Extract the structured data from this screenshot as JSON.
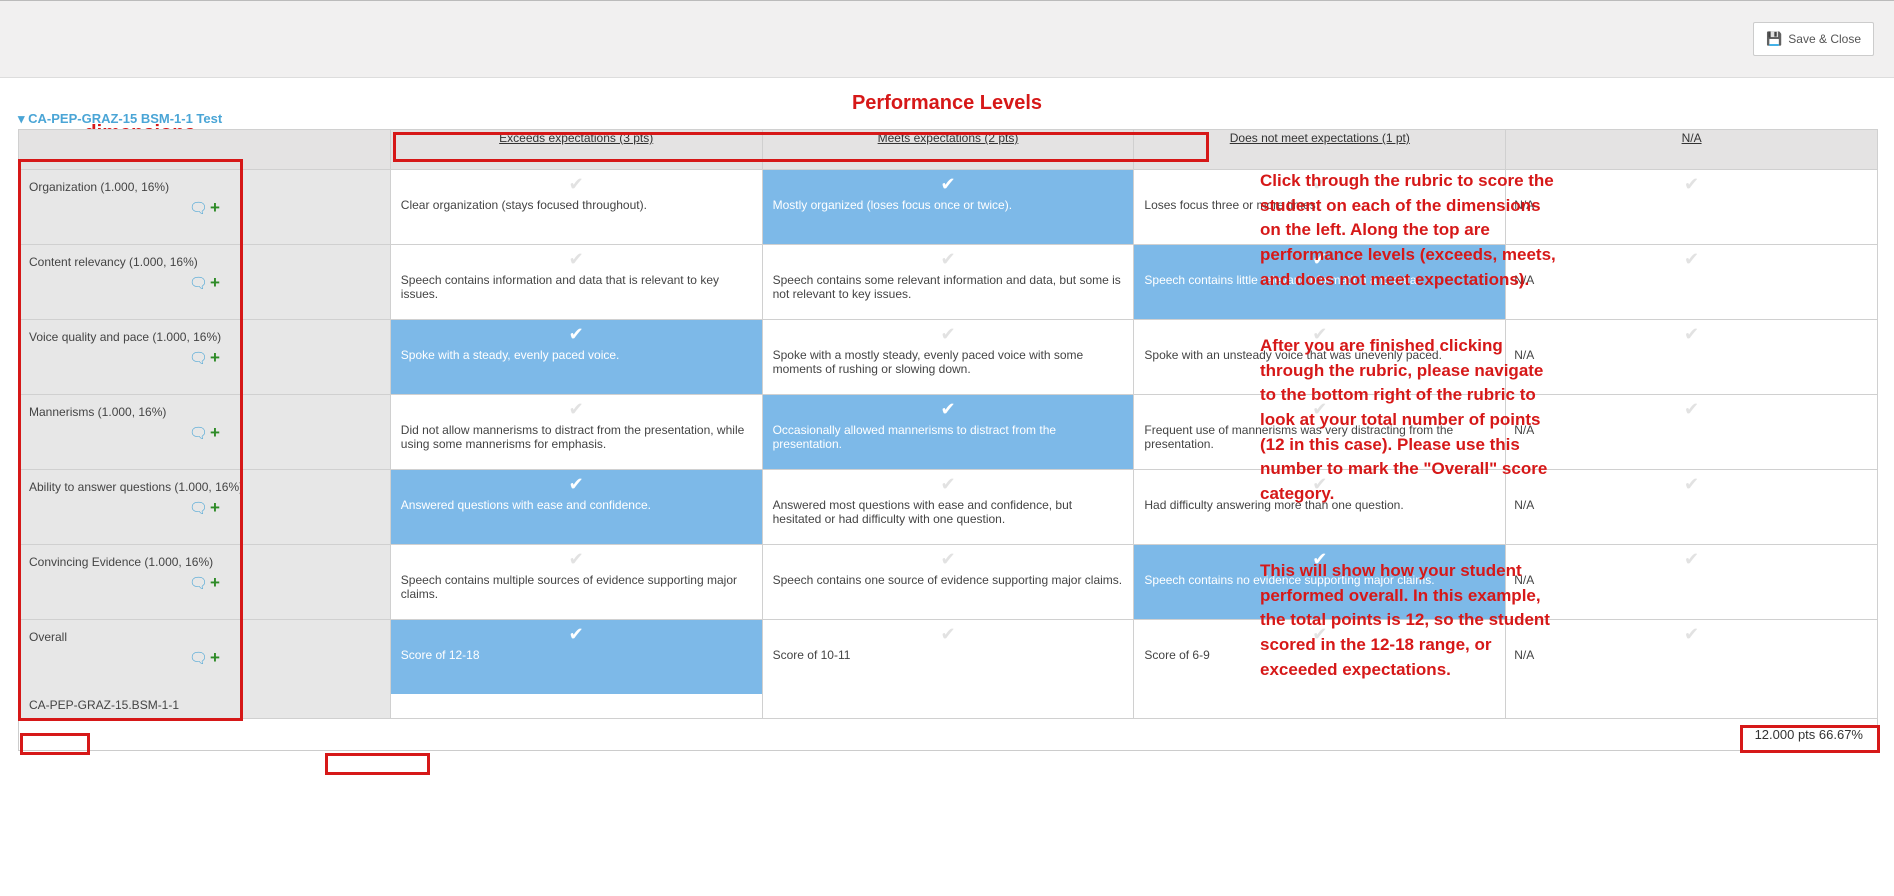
{
  "toolbar": {
    "save_close": "Save & Close"
  },
  "labels": {
    "performance_levels": "Performance Levels",
    "dimensions": "dimensions",
    "breadcrumb": "▾ CA-PEP-GRAZ-15 BSM-1-1 Test"
  },
  "headers": {
    "exceeds": "Exceeds expectations (3 pts)",
    "meets": "Meets expectations (2 pts)",
    "doesnot": "Does not meet expectations (1 pt)",
    "na": "N/A"
  },
  "rows": [
    {
      "dim": "Organization (1.000, 16%)",
      "c1": "Clear organization (stays focused throughout).",
      "c2": "Mostly organized (loses focus once or twice).",
      "c3": "Loses focus three or more times.",
      "selected_idx": 1
    },
    {
      "dim": "Content relevancy (1.000, 16%)",
      "c1": "Speech contains information and data that is relevant to key issues.",
      "c2": "Speech contains some relevant information and data, but some is not relevant to key issues.",
      "c3": "Speech contains little relevant information and data.",
      "selected_idx": 2
    },
    {
      "dim": "Voice quality and pace (1.000, 16%)",
      "c1": "Spoke with a steady, evenly paced voice.",
      "c2": "Spoke with a mostly steady, evenly paced voice with some moments of rushing or slowing down.",
      "c3": "Spoke with an unsteady voice that was unevenly paced.",
      "selected_idx": 0
    },
    {
      "dim": "Mannerisms (1.000, 16%)",
      "c1": "Did not allow mannerisms to distract from the presentation, while using some mannerisms for emphasis.",
      "c2": "Occasionally allowed mannerisms to distract from the presentation.",
      "c3": "Frequent use of mannerisms was very distracting from the presentation.",
      "selected_idx": 1
    },
    {
      "dim": "Ability to answer questions (1.000, 16%)",
      "c1": "Answered questions with ease and confidence.",
      "c2": "Answered most questions with ease and confidence, but hesitated or had difficulty with one question.",
      "c3": "Had difficulty answering more than one question.",
      "selected_idx": 0
    },
    {
      "dim": "Convincing Evidence (1.000, 16%)",
      "c1": "Speech contains multiple sources of evidence supporting major claims.",
      "c2": "Speech contains one source of evidence supporting major claims.",
      "c3": "Speech contains no evidence supporting major claims.",
      "selected_idx": 2
    },
    {
      "dim": "Overall",
      "dim2": "CA-PEP-GRAZ-15.BSM-1-1",
      "c1": "Score of 12-18",
      "c2": "Score of 10-11",
      "c3": "Score of 6-9",
      "selected_idx": 0
    }
  ],
  "na_text": "N/A",
  "summary": "12.000 pts 66.67%",
  "annotations": {
    "a1": "Click through the rubric to score the student on each of the dimensions on the left. Along the top are performance levels (exceeds, meets, and does not meet expectations).",
    "a2": "After you are finished clicking through the rubric, please navigate to the bottom right of the rubric to look at your total number of points (12 in this case). Please use this number to mark the \"Overall\" score category.",
    "a3": "This will show how your student performed overall. In this example, the total points is 12, so the student scored in the 12-18 range, or exceeded expectations."
  }
}
